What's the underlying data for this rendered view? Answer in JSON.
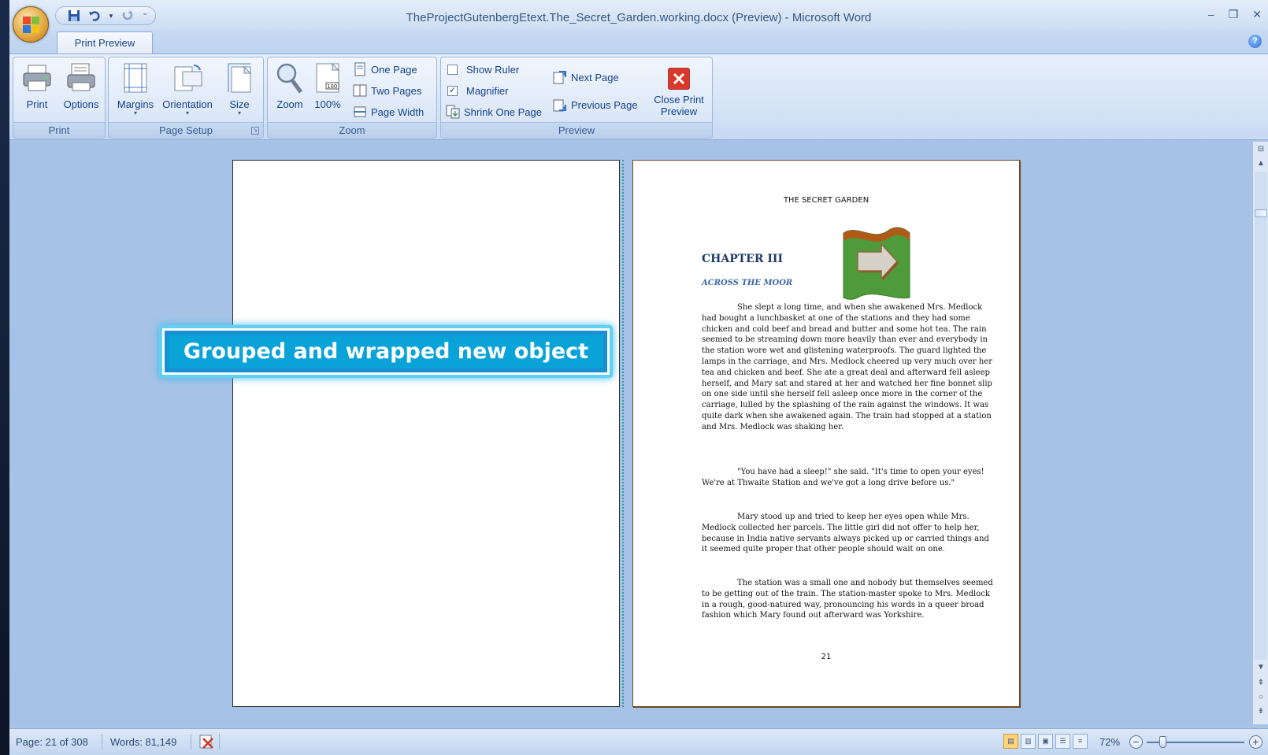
{
  "window": {
    "title": "TheProjectGutenbergEtext.The_Secret_Garden.working.docx (Preview) - Microsoft Word",
    "controls": [
      "–",
      "❐",
      "✕"
    ]
  },
  "tabs": [
    {
      "label": "Print Preview",
      "active": true
    }
  ],
  "ribbon": {
    "groups": [
      {
        "name": "Print",
        "buttons": [
          {
            "label": "Print",
            "icon": "printer-icon"
          },
          {
            "label": "Options",
            "icon": "options-icon"
          }
        ]
      },
      {
        "name": "Page Setup",
        "buttons": [
          {
            "label": "Margins",
            "icon": "margins-icon"
          },
          {
            "label": "Orientation",
            "icon": "orientation-icon"
          },
          {
            "label": "Size",
            "icon": "size-icon"
          }
        ]
      },
      {
        "name": "Zoom",
        "buttons": [
          {
            "label": "Zoom",
            "icon": "magnifier-icon"
          },
          {
            "label": "100%",
            "icon": "page-100-icon"
          }
        ],
        "small": [
          {
            "label": "One Page"
          },
          {
            "label": "Two Pages"
          },
          {
            "label": "Page Width"
          }
        ]
      },
      {
        "name": "Preview",
        "checkboxes": [
          {
            "label": "Show Ruler",
            "checked": false
          },
          {
            "label": "Magnifier",
            "checked": true
          }
        ],
        "small": [
          {
            "label": "Shrink One Page"
          },
          {
            "label": "Next Page"
          },
          {
            "label": "Previous Page"
          }
        ],
        "close": {
          "line1": "Close Print",
          "line2": "Preview"
        }
      }
    ]
  },
  "document": {
    "running_head": "THE SECRET GARDEN",
    "chapter": "CHAPTER III",
    "subtitle": "ACROSS THE MOOR",
    "paragraphs": [
      "She slept a long time, and when she awakened Mrs. Medlock had bought a lunchbasket at one of the stations and they had some chicken and cold beef and bread and butter and some hot tea.  The rain seemed to be streaming down more heavily than ever and everybody in the station wore wet and glistening waterproofs.  The guard lighted the lamps in the carriage, and Mrs. Medlock cheered up very much over her tea and chicken and beef.  She ate a great deal and afterward fell asleep herself, and Mary sat and stared at her and watched her fine bonnet slip on one side until she herself fell asleep once more in the corner of the carriage, lulled by the splashing of the rain against the windows. It was quite dark when she awakened again.  The train had stopped at a station and Mrs. Medlock was shaking her.",
      "\"You have had a sleep!\" she said.  \"It's time to open your eyes! We're at Thwaite Station and we've got a long drive before us.\"",
      "Mary stood up and tried to keep her eyes open while Mrs. Medlock collected her parcels.  The little girl did not offer to help her, because in India native servants always picked up or carried things and it seemed quite proper that other people should wait on one.",
      "The station was a small one and nobody but themselves seemed to be getting out of the train.  The station-master spoke to Mrs. Medlock in a rough, good-natured way, pronouncing his words in a queer broad fashion which Mary found out afterward was Yorkshire."
    ],
    "page_number": "21"
  },
  "callout": {
    "text": "Grouped and wrapped new object"
  },
  "statusbar": {
    "page": "Page: 21 of 308",
    "words": "Words: 81,149",
    "zoom": "72%",
    "zoom_fraction": 0.72
  },
  "colors": {
    "accent": "#15428b",
    "callout": "#0aa3d8",
    "ribbon": "#d3e2f6",
    "doc_bg": "#a6c2e6"
  }
}
